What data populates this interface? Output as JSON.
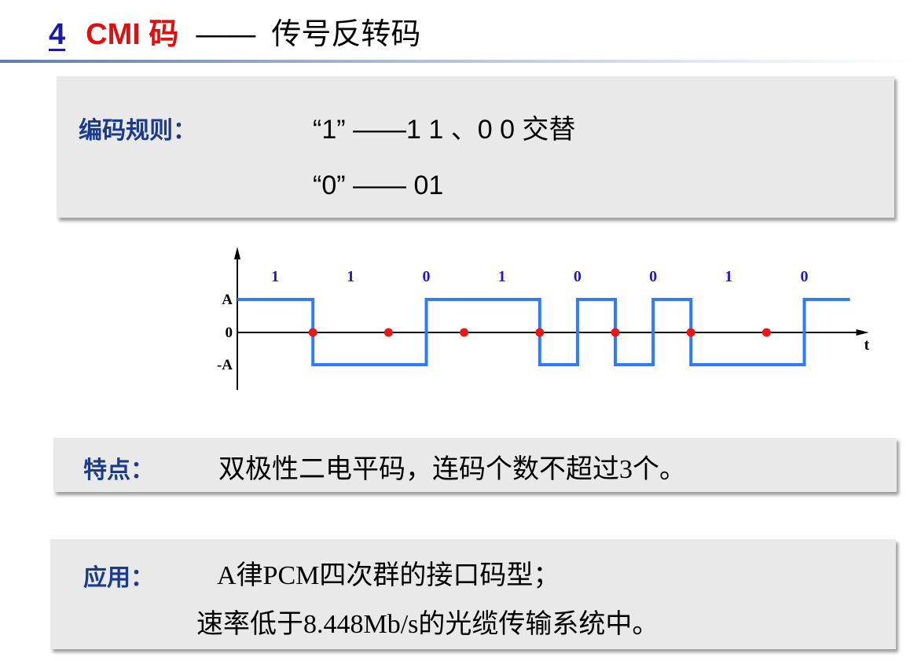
{
  "title": {
    "number": "4",
    "name": "CMI 码",
    "dash": "——",
    "subtitle": "传号反转码"
  },
  "rules": {
    "label": "编码规则：",
    "one_rule": "“1” ——1 1 、0 0 交替",
    "zero_rule": "“0” —— 01"
  },
  "waveform": {
    "bits": [
      "1",
      "1",
      "0",
      "1",
      "0",
      "0",
      "1",
      "0"
    ],
    "levels": [
      "A",
      "0",
      "-A"
    ],
    "time_label": "t",
    "colors": {
      "signal": "#2f7df6",
      "marker": "#e81818",
      "axis": "#000000",
      "bits": "#1a1acc"
    }
  },
  "features": {
    "label": "特点：",
    "text": "双极性二电平码，连码个数不超过3个。"
  },
  "application": {
    "label": "应用：",
    "line1": "A律PCM四次群的接口码型；",
    "line2": "速率低于8.448Mb/s的光缆传输系统中。"
  }
}
